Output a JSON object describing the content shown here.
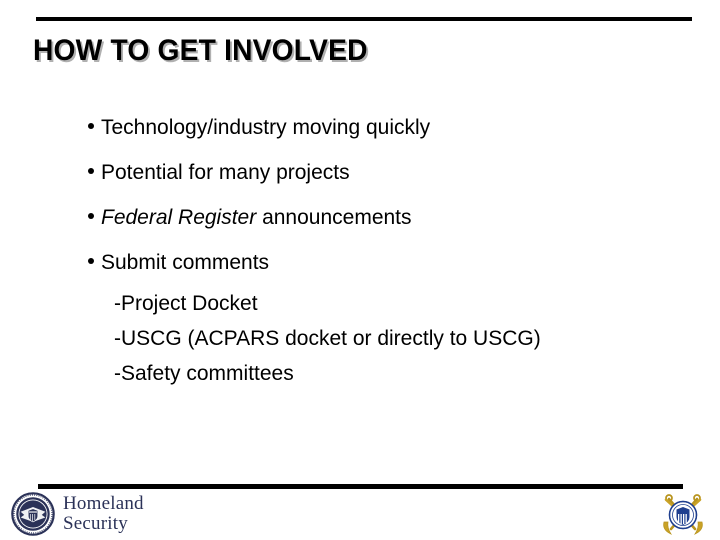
{
  "slide": {
    "title": "HOW TO GET INVOLVED",
    "background_color": "#ffffff",
    "text_color": "#000000",
    "rule_color": "#000000"
  },
  "bullets": [
    {
      "text": "Technology/industry moving quickly",
      "italic_prefix": ""
    },
    {
      "text": "Potential for many projects",
      "italic_prefix": ""
    },
    {
      "text": " announcements",
      "italic_prefix": "Federal Register"
    },
    {
      "text": "Submit comments",
      "italic_prefix": ""
    }
  ],
  "sub_items": [
    {
      "text": "-Project Docket"
    },
    {
      "text": "-USCG (ACPARS docket or directly to USCG)"
    },
    {
      "text": "-Safety committees"
    }
  ],
  "footer": {
    "dhs": {
      "line1": "Homeland",
      "line2": "Security",
      "wordmark_color": "#2b3258",
      "seal_name": "dhs-seal"
    },
    "uscg": {
      "emblem_name": "uscg-emblem",
      "anchor_color": "#c9a227",
      "shield_color": "#1f3f8f"
    }
  }
}
